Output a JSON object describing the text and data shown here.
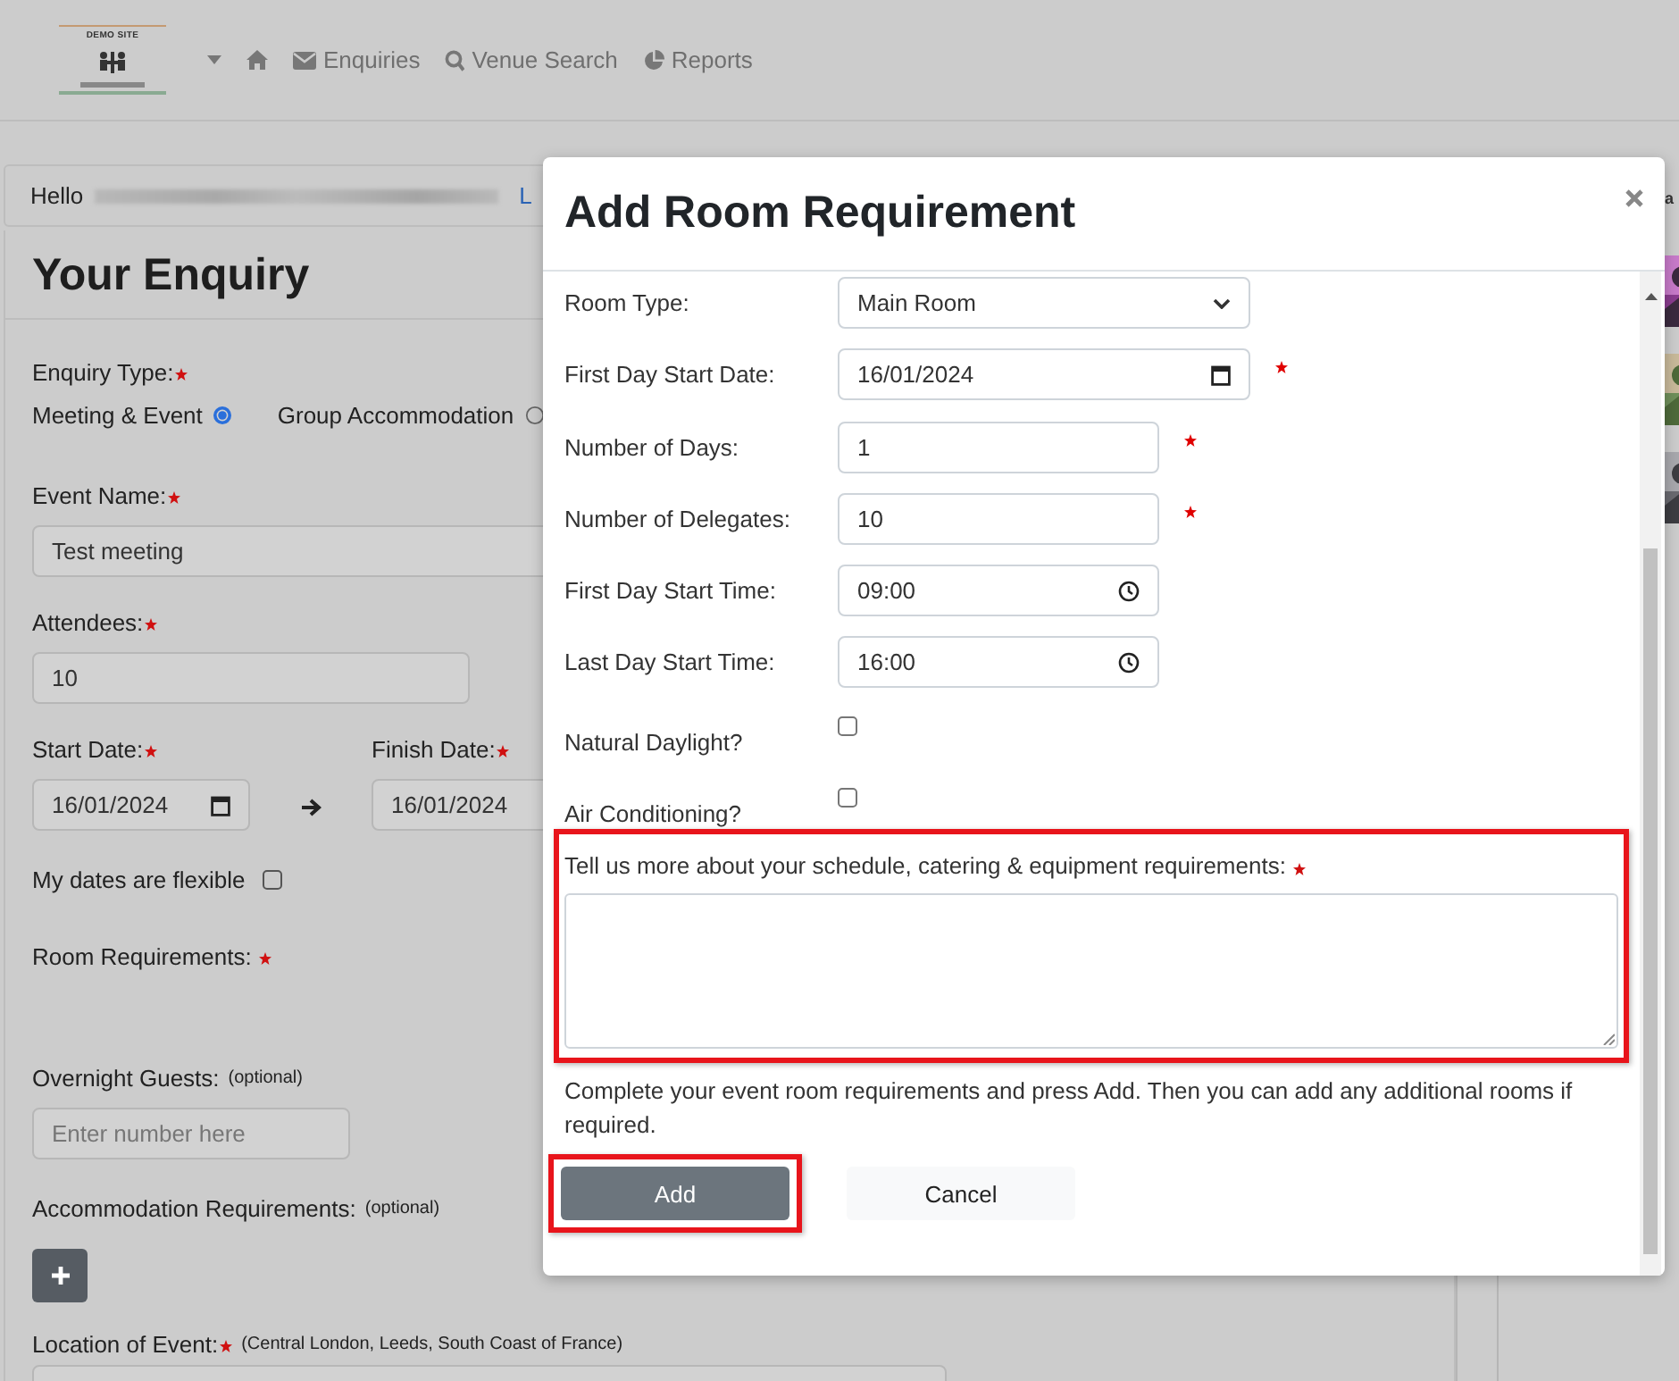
{
  "header": {
    "logo": {
      "title": "DEMO SITE"
    },
    "nav": [
      {
        "kind": "dropdown"
      },
      {
        "kind": "home"
      },
      {
        "kind": "mail",
        "label": "Enquiries"
      },
      {
        "kind": "search",
        "label": "Venue Search"
      },
      {
        "kind": "chart",
        "label": "Reports"
      }
    ]
  },
  "greeting": {
    "text": "Hello",
    "link": "L"
  },
  "side_panel": {
    "heading": "a"
  },
  "enquiry": {
    "title": "Your Enquiry",
    "enquiry_type": {
      "label": "Enquiry Type:",
      "required": true,
      "options": [
        {
          "label": "Meeting & Event",
          "selected": true
        },
        {
          "label": "Group Accommodation",
          "selected": false
        }
      ]
    },
    "event_name": {
      "label": "Event Name:",
      "required": true,
      "value": "Test meeting"
    },
    "attendees": {
      "label": "Attendees:",
      "required": true,
      "value": "10"
    },
    "start_date": {
      "label": "Start Date:",
      "required": true,
      "value": "16/01/2024"
    },
    "finish_date": {
      "label": "Finish Date:",
      "required": true,
      "value": "16/01/2024"
    },
    "flexible": {
      "label": "My dates are flexible",
      "checked": false
    },
    "room_requirements": {
      "label": "Room Requirements:",
      "required": true
    },
    "overnight_guests": {
      "label": "Overnight Guests:",
      "note": "(optional)",
      "placeholder": "Enter number here"
    },
    "accommodation": {
      "label": "Accommodation Requirements:",
      "note": "(optional)"
    },
    "location": {
      "label": "Location of Event:",
      "required": true,
      "note": "(Central London, Leeds, South Coast of France)"
    }
  },
  "modal": {
    "title": "Add Room Requirement",
    "rows": [
      {
        "kind": "select",
        "label": "Room Type:",
        "value": "Main Room",
        "required": false
      },
      {
        "kind": "date",
        "label": "First Day Start Date:",
        "value": "16/01/2024",
        "required": true
      },
      {
        "kind": "text",
        "label": "Number of Days:",
        "value": "1",
        "required": true
      },
      {
        "kind": "text",
        "label": "Number of Delegates:",
        "value": "10",
        "required": true
      },
      {
        "kind": "time",
        "label": "First Day Start Time:",
        "value": "09:00",
        "required": false
      },
      {
        "kind": "time",
        "label": "Last Day Start Time:",
        "value": "16:00",
        "required": false
      },
      {
        "kind": "checkbox",
        "label": "Natural Daylight?",
        "checked": false
      },
      {
        "kind": "checkbox",
        "label": "Air Conditioning?",
        "checked": false
      }
    ],
    "details": {
      "label": "Tell us more about your schedule, catering & equipment requirements:",
      "required": true,
      "highlighted": true
    },
    "note": "Complete your event room requirements and press Add. Then you can add any additional rooms if required.",
    "buttons": [
      {
        "kind": "primary",
        "label": "Add",
        "highlighted": true
      },
      {
        "kind": "secondary",
        "label": "Cancel",
        "highlighted": false
      }
    ]
  }
}
